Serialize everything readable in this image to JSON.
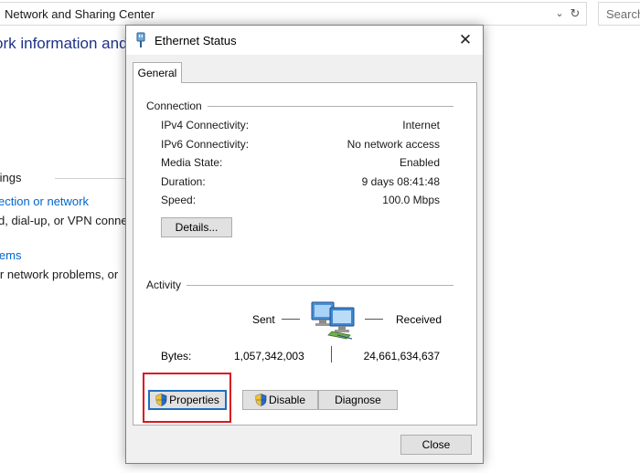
{
  "background_window": {
    "address_text": "Network and Sharing Center",
    "search_placeholder": "Search",
    "heading": "ork information and",
    "settings_label": "tings",
    "link1": "ection or network",
    "desc1": "d, dial-up, or VPN conne",
    "link2": "lems",
    "desc2": "ir network problems, or"
  },
  "dialog": {
    "title": "Ethernet Status",
    "tab": "General",
    "connection": {
      "group_label": "Connection",
      "rows": [
        {
          "label": "IPv4 Connectivity:",
          "value": "Internet"
        },
        {
          "label": "IPv6 Connectivity:",
          "value": "No network access"
        },
        {
          "label": "Media State:",
          "value": "Enabled"
        },
        {
          "label": "Duration:",
          "value": "9 days 08:41:48"
        },
        {
          "label": "Speed:",
          "value": "100.0 Mbps"
        }
      ],
      "details_button": "Details..."
    },
    "activity": {
      "group_label": "Activity",
      "sent_label": "Sent",
      "received_label": "Received",
      "bytes_label": "Bytes:",
      "bytes_sent": "1,057,342,003",
      "bytes_received": "24,661,634,637"
    },
    "buttons": {
      "properties": "Properties",
      "disable": "Disable",
      "diagnose": "Diagnose",
      "close": "Close"
    }
  },
  "colors": {
    "highlight": "#d9161f",
    "heading_blue": "#1e3287",
    "link_blue": "#0066cc"
  },
  "icons": [
    "ethernet-icon",
    "close-icon",
    "network-computers-icon",
    "shield-icon",
    "chevron-down-icon",
    "refresh-icon"
  ]
}
